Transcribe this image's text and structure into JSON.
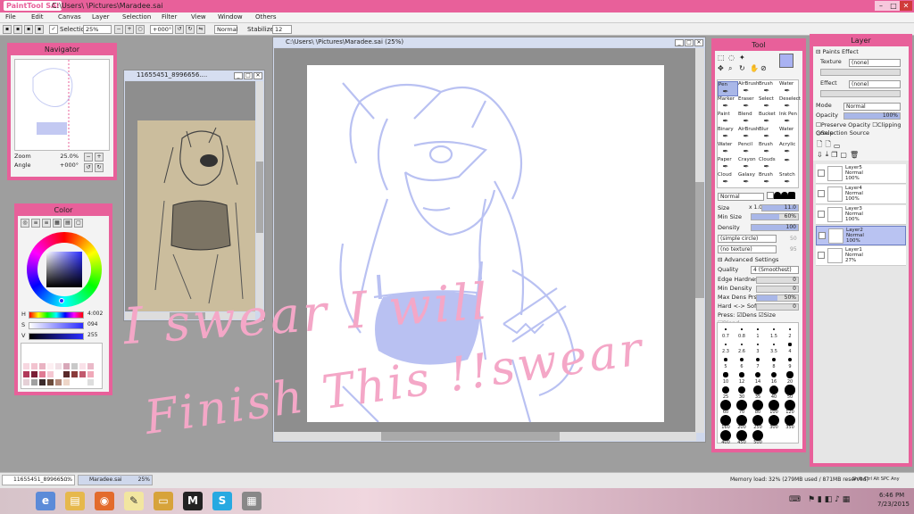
{
  "titlebar": {
    "logo": "PaintTool SAI",
    "path": "C:\\Users\\        \\Pictures\\Maradee.sai"
  },
  "menu": [
    "File",
    "Edit",
    "Canvas",
    "Layer",
    "Selection",
    "Filter",
    "View",
    "Window",
    "Others"
  ],
  "options": {
    "selection": "Selection",
    "zoom": "25%",
    "angle": "+000°",
    "blend": "Normal",
    "stabilizer_label": "Stabilizer",
    "stabilizer": "12"
  },
  "navigator": {
    "title": "Navigator",
    "zoom_label": "Zoom",
    "zoom": "25.0%",
    "angle_label": "Angle",
    "angle": "+000°"
  },
  "color": {
    "title": "Color",
    "h_label": "H",
    "h": "4:002",
    "s_label": "S",
    "s": "094",
    "v_label": "V",
    "v": "255"
  },
  "reference_window": {
    "title": "11655451_8996656...."
  },
  "canvas_window": {
    "title": "C:\\Users\\        \\Pictures\\Maradee.sai (25%)"
  },
  "handwriting": {
    "line1": "I swear  I will",
    "line2": "Finish  This  !!swear"
  },
  "tool": {
    "title": "Tool",
    "tools": [
      [
        "Pen",
        "AirBrush",
        "Brush",
        "Water"
      ],
      [
        "Marker",
        "Eraser",
        "Select",
        "Deselect"
      ],
      [
        "Paint",
        "Blend",
        "Bucket",
        "Ink Pen"
      ],
      [
        "Binary",
        "AirBrush",
        "Blur",
        "Water"
      ],
      [
        "Water",
        "Pencil",
        "Brush",
        "Acrylic"
      ],
      [
        "Paper",
        "Crayon",
        "Clouds",
        ""
      ],
      [
        "Cloud",
        "Galaxy",
        "Brush",
        "Sratch"
      ]
    ],
    "blend_mode": "Normal",
    "size_label": "Size",
    "size_mult": "x 1.0",
    "size": "11.0",
    "min_size_label": "Min Size",
    "min_size": "60%",
    "density_label": "Density",
    "density": "100",
    "shape": "(simple circle)",
    "shape_val": "50",
    "texture": "(no texture)",
    "texture_val": "95",
    "advanced_label": "Advanced Settings",
    "quality_label": "Quality",
    "quality": "4 (Smoothest)",
    "edge_label": "Edge Hardness",
    "edge": "0",
    "min_density_label": "Min Density",
    "min_density": "0",
    "max_dens_label": "Max Dens Prs.",
    "max_dens": "50%",
    "hard_soft_label": "Hard <-> Soft",
    "hard_soft": "0",
    "press_label": "Press:",
    "press_dens": "Dens",
    "press_size": "Size",
    "press_blend": "Blend",
    "brush_sizes": [
      [
        "0.7",
        "0.8",
        "1",
        "1.5",
        "2"
      ],
      [
        "2.3",
        "2.6",
        "3",
        "3.5",
        "4"
      ],
      [
        "5",
        "6",
        "7",
        "8",
        "9"
      ],
      [
        "10",
        "12",
        "14",
        "16",
        "20"
      ],
      [
        "25",
        "30",
        "35",
        "40",
        "50"
      ],
      [
        "60",
        "70",
        "80",
        "100",
        "120"
      ],
      [
        "160",
        "200",
        "250",
        "300",
        "350"
      ],
      [
        "400",
        "450",
        "500",
        "",
        ""
      ]
    ]
  },
  "layer": {
    "title": "Layer",
    "paints_effect": "Paints Effect",
    "texture_label": "Texture",
    "texture": "(none)",
    "effect_label": "Effect",
    "effect": "(none)",
    "mode_label": "Mode",
    "mode": "Normal",
    "opacity_label": "Opacity",
    "opacity": "100%",
    "preserve": "Preserve Opacity",
    "clipping": "Clipping Group",
    "selection_source": "Selection Source",
    "layers": [
      {
        "name": "Layer5",
        "mode": "Normal",
        "opacity": "100%"
      },
      {
        "name": "Layer4",
        "mode": "Normal",
        "opacity": "100%"
      },
      {
        "name": "Layer3",
        "mode": "Normal",
        "opacity": "100%"
      },
      {
        "name": "Layer2",
        "mode": "Normal",
        "opacity": "100%"
      },
      {
        "name": "Layer1",
        "mode": "Normal",
        "opacity": "27%"
      }
    ]
  },
  "docs": [
    {
      "name": "11655451_899665...",
      "zoom": "50%"
    },
    {
      "name": "Maradee.sai",
      "zoom": "25%"
    }
  ],
  "status": {
    "memory": "Memory load: 32% (279MB used / 871MB reserved)",
    "keys": "Shift Ctrl Alt SPC Any"
  },
  "taskbar": {
    "time": "6:46 PM",
    "date": "7/23/2015"
  },
  "colors": {
    "panel": "#e8609a",
    "sketch": "#b9c1f2",
    "handwriting": "#f4a7c7"
  }
}
